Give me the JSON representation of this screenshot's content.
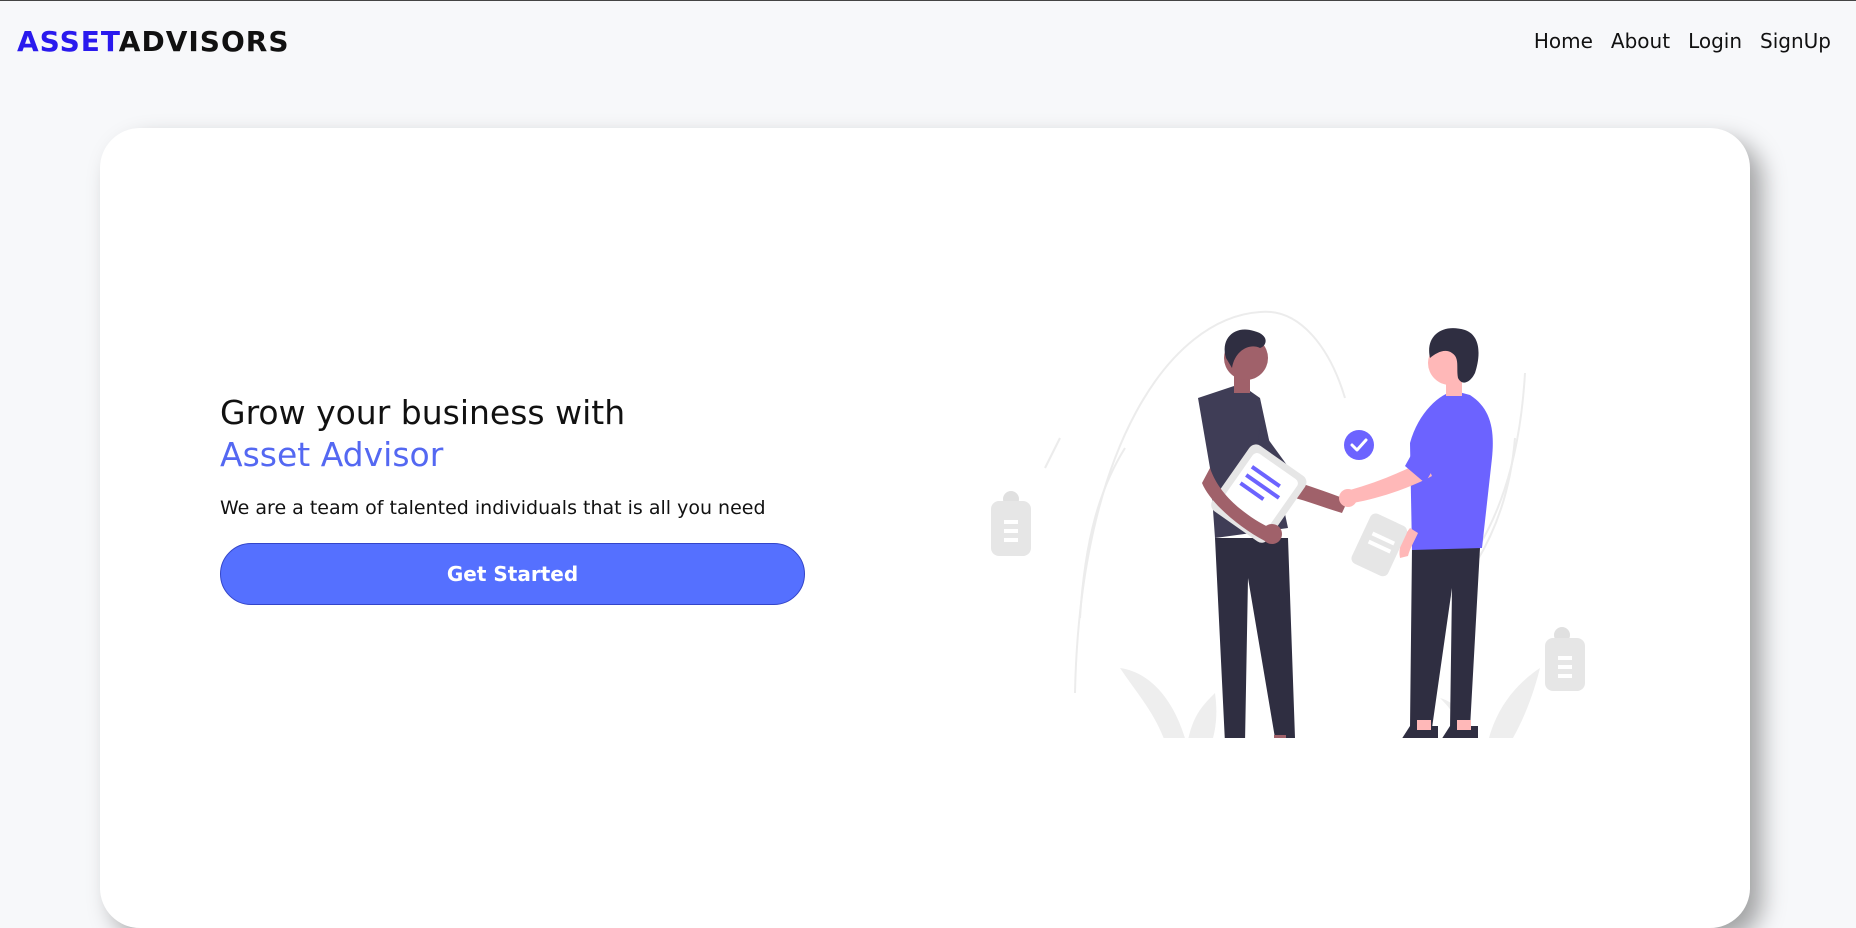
{
  "navbar": {
    "logo_part1": "ASSET",
    "logo_part2": "ADVISORS",
    "links": [
      "Home",
      "About",
      "Login",
      "SignUp"
    ]
  },
  "hero": {
    "title_line1": "Grow your business with",
    "title_brand": "Asset Advisor",
    "subtitle": "We are a team of talented individuals that is all you need",
    "cta_label": "Get Started"
  },
  "colors": {
    "brand_blue": "#2a1aee",
    "accent": "#5468f2",
    "button": "#5570ff",
    "illustration_purple": "#6c63ff"
  }
}
